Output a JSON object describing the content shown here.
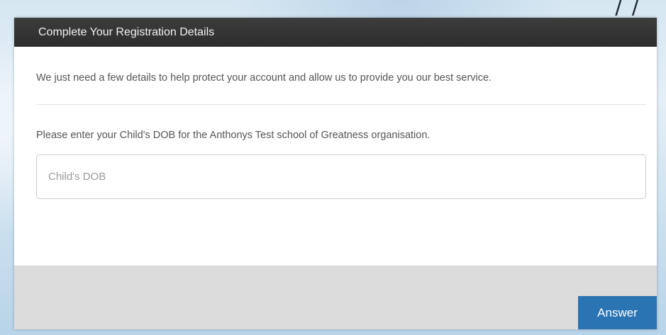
{
  "background": {
    "partial_text": "/ /"
  },
  "dialog": {
    "title": "Complete Your Registration Details",
    "intro": "We just need a few details to help protect your account and allow us to provide you our best service.",
    "prompt": "Please enter your Child's DOB for the Anthonys Test school of Greatness organisation.",
    "dob_field": {
      "value": "",
      "placeholder": "Child's DOB"
    },
    "answer_label": "Answer"
  },
  "colors": {
    "header_bg": "#333333",
    "button_bg": "#2b74b3",
    "footer_bg": "#dcdcdc"
  }
}
